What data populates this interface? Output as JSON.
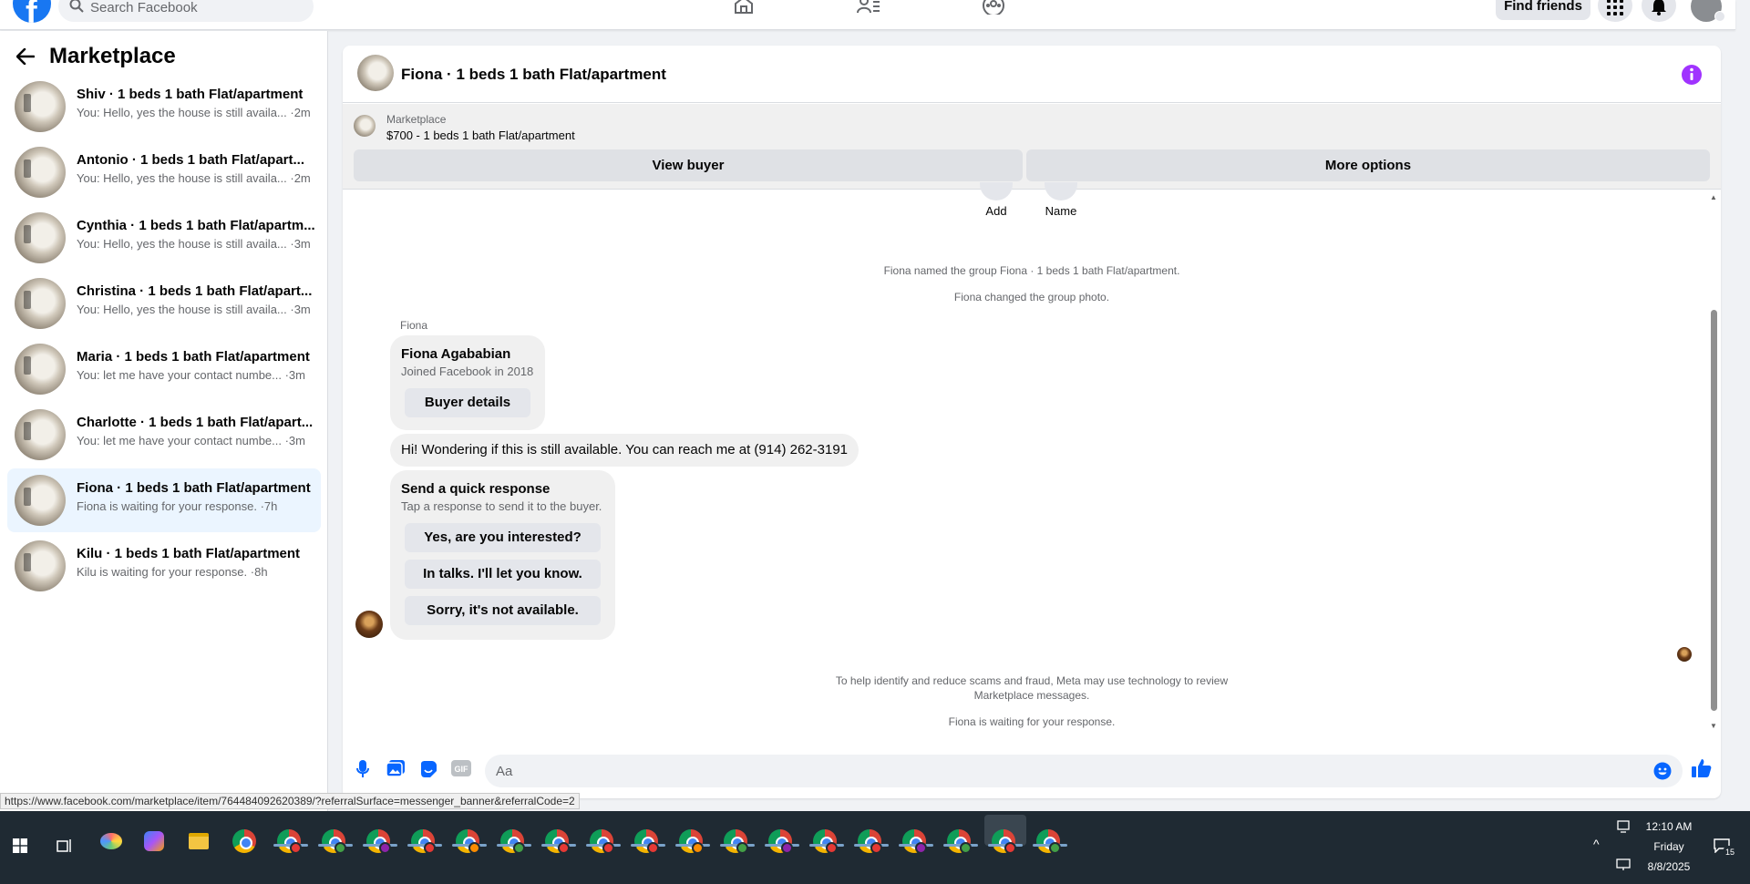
{
  "topnav": {
    "search_placeholder": "Search Facebook",
    "find_friends": "Find friends"
  },
  "sidebar": {
    "title": "Marketplace",
    "conversations": [
      {
        "name": "Shiv · 1 beds 1 bath Flat/apartment",
        "preview": "You: Hello, yes the house is still availa... ·2m"
      },
      {
        "name": "Antonio · 1 beds 1 bath Flat/apart...",
        "preview": "You: Hello, yes the house is still availa... ·2m"
      },
      {
        "name": "Cynthia · 1 beds 1 bath Flat/apartm...",
        "preview": "You: Hello, yes the house is still availa... ·3m"
      },
      {
        "name": "Christina · 1 beds 1 bath Flat/apart...",
        "preview": "You: Hello, yes the house is still availa... ·3m"
      },
      {
        "name": "Maria · 1 beds 1 bath Flat/apartment",
        "preview": "You: let me have your contact numbe... ·3m"
      },
      {
        "name": "Charlotte · 1 beds 1 bath Flat/apart...",
        "preview": "You: let me have your contact numbe... ·3m"
      },
      {
        "name": "Fiona · 1 beds 1 bath Flat/apartment",
        "preview": "Fiona is waiting for your response. ·7h"
      },
      {
        "name": "Kilu · 1 beds 1 bath Flat/apartment",
        "preview": "Kilu is waiting for your response. ·8h"
      }
    ]
  },
  "chat": {
    "title": "Fiona · 1 beds 1 bath Flat/apartment",
    "banner": {
      "label": "Marketplace",
      "listing": "$700 - 1 beds 1 bath Flat/apartment",
      "view_buyer": "View buyer",
      "more_options": "More options"
    },
    "quick_actions": {
      "add": "Add",
      "name": "Name"
    },
    "system": {
      "named": "Fiona named the group Fiona · 1 beds 1 bath Flat/apartment.",
      "photo": "Fiona changed the group photo.",
      "scam_line1": "To help identify and reduce scams and fraud, Meta may use technology to review",
      "scam_line2": "Marketplace messages.",
      "waiting": "Fiona is waiting for your response."
    },
    "sender": "Fiona",
    "profile_card": {
      "name": "Fiona Agababian",
      "joined": "Joined Facebook in 2018",
      "button": "Buyer details"
    },
    "message": "Hi! Wondering if this is still available. You can reach me at (914) 262-3191",
    "quick_response": {
      "title": "Send a quick response",
      "subtitle": "Tap a response to send it to the buyer.",
      "options": [
        "Yes, are you interested?",
        "In talks. I'll let you know.",
        "Sorry, it's not available."
      ]
    },
    "composer_placeholder": "Aa"
  },
  "status_url": "https://www.facebook.com/marketplace/item/764484092620389/?referralSurface=messenger_banner&referralCode=2",
  "taskbar": {
    "time": "12:10 AM",
    "day": "Friday",
    "date": "8/8/2025",
    "notification_count": "15"
  },
  "colors": {
    "fb_blue": "#1877f2",
    "info_purple": "#a033ff",
    "active_conv": "#ebf5ff",
    "taskbar": "#1f2a33"
  }
}
